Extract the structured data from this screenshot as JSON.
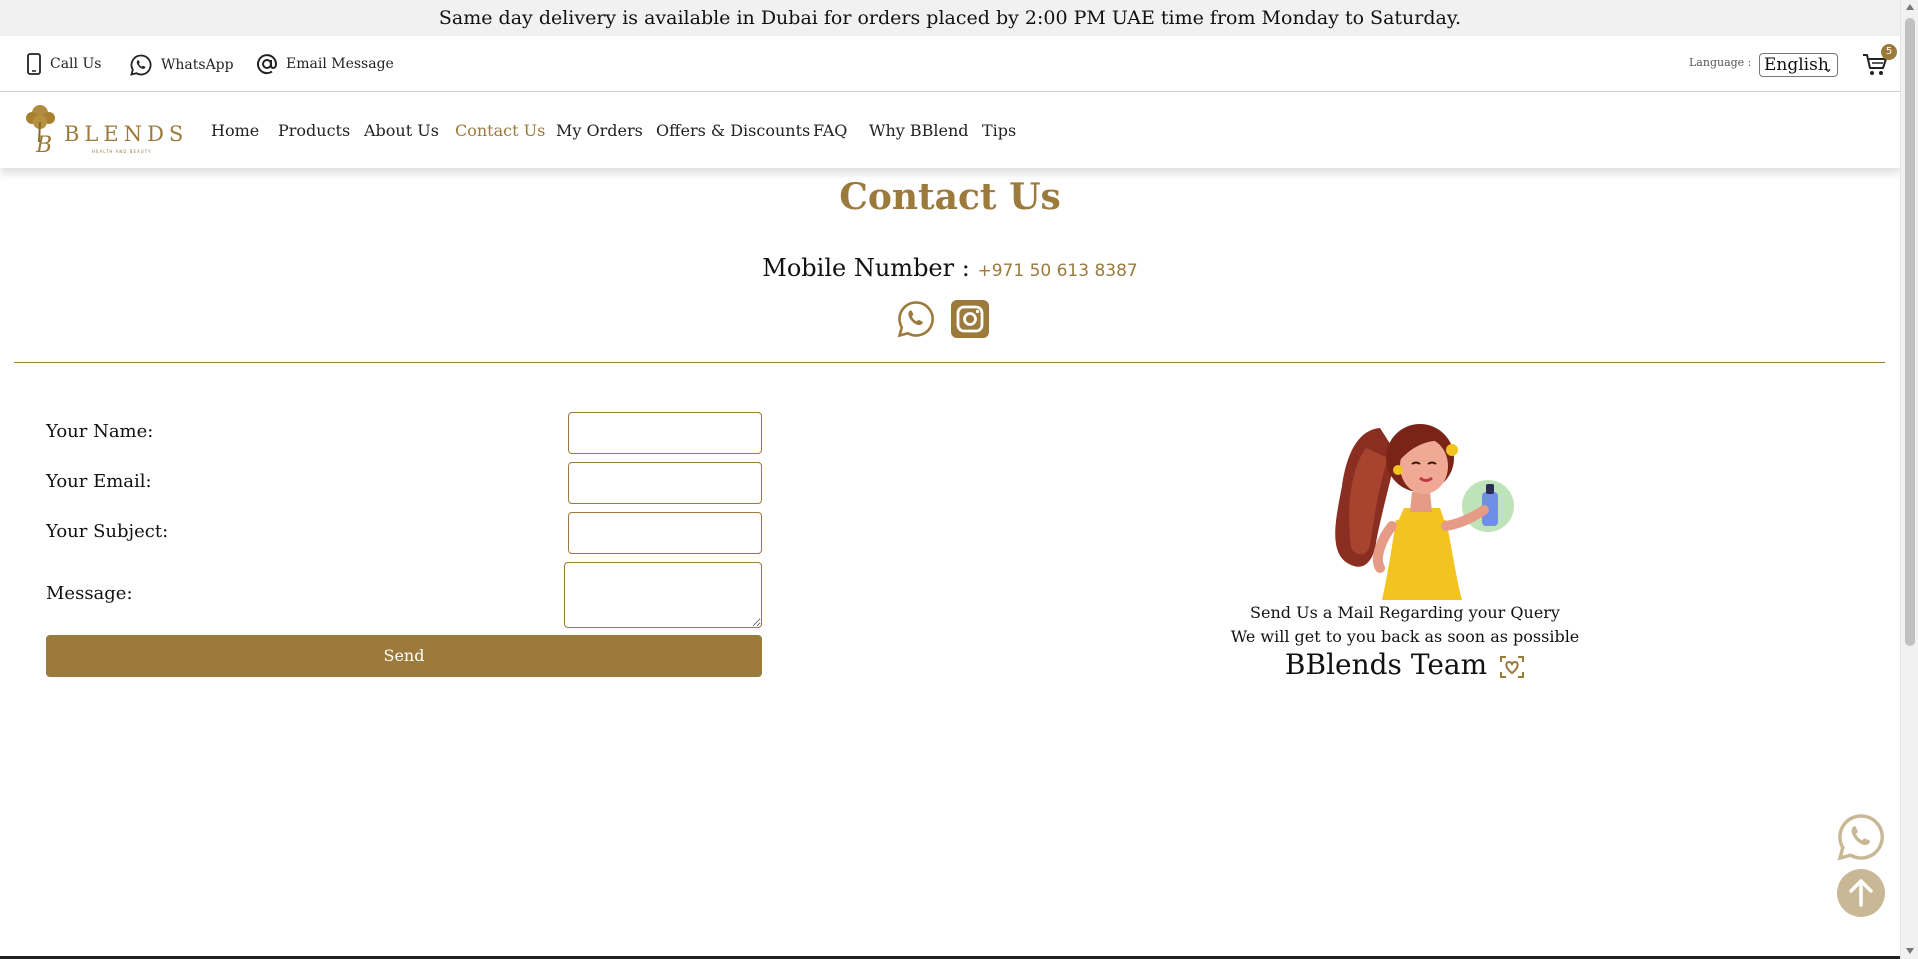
{
  "announcement": "Same day delivery is available in Dubai for orders placed by 2:00 PM UAE time from Monday to Saturday.",
  "topbar": {
    "call_label": "Call Us",
    "whatsapp_label": "WhatsApp",
    "email_label": "Email Message",
    "language_label": "Language :",
    "language_value": "English",
    "cart_count": "5"
  },
  "nav": {
    "items": [
      {
        "label": "Home"
      },
      {
        "label": "Products"
      },
      {
        "label": "About Us"
      },
      {
        "label": "Contact Us",
        "active": true
      },
      {
        "label": "My Orders"
      },
      {
        "label": "Offers & Discounts"
      },
      {
        "label": "FAQ"
      },
      {
        "label": "Why BBlend"
      },
      {
        "label": "Tips"
      }
    ]
  },
  "logo": {
    "text": "BLENDS",
    "subtext": "HEALTH AND BEAUTY",
    "monogram": "B"
  },
  "contact": {
    "title": "Contact Us",
    "mobile_label": "Mobile Number :",
    "mobile_number": "+971 50 613 8387"
  },
  "form": {
    "name_label": "Your Name:",
    "email_label": "Your Email:",
    "subject_label": "Your Subject:",
    "message_label": "Message:",
    "send_label": "Send"
  },
  "side": {
    "line1": "Send Us a Mail Regarding your Query",
    "line2": "We will get to you back as soon as possible",
    "team": "BBlends Team"
  },
  "colors": {
    "accent": "#9b7a3b",
    "float_button": "#c9b896",
    "announcement_bg": "#f1f1f1"
  },
  "icons": [
    "phone-icon",
    "whatsapp-icon",
    "at-sign-icon",
    "cart-icon",
    "instagram-icon",
    "heart-icon",
    "arrow-up-icon"
  ]
}
